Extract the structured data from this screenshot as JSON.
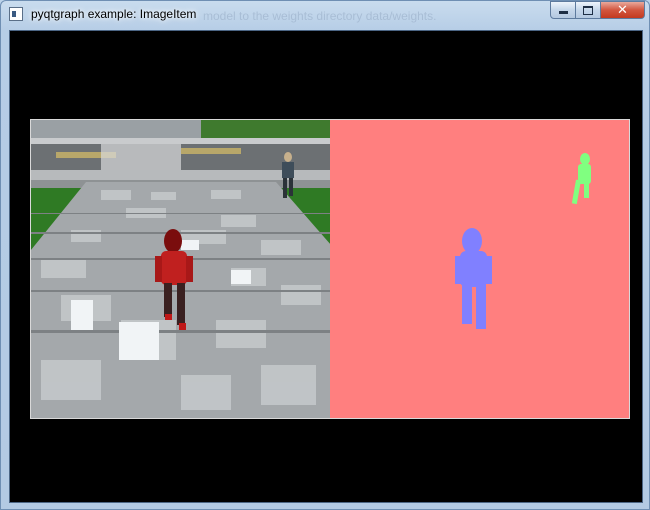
{
  "window": {
    "title": "pyqtgraph example: ImageItem",
    "background_text": "model to the weights directory data/weights.",
    "controls": {
      "minimize_icon": "minimize-icon",
      "maximize_icon": "maximize-icon",
      "close_icon": "close-icon",
      "close_glyph": "✕"
    }
  },
  "images": {
    "left": {
      "description_icon": "camera-frame",
      "figures": [
        "person-red",
        "person-far"
      ]
    },
    "right": {
      "background_color": "#ff7f7f",
      "segments": [
        {
          "name": "person-near",
          "color": "#8080ff"
        },
        {
          "name": "person-far",
          "color": "#80ff80"
        }
      ]
    }
  },
  "colors": {
    "plot_background": "#000000",
    "frame_border": "#d9d9d9",
    "titlebar": "#b9cfe7"
  }
}
